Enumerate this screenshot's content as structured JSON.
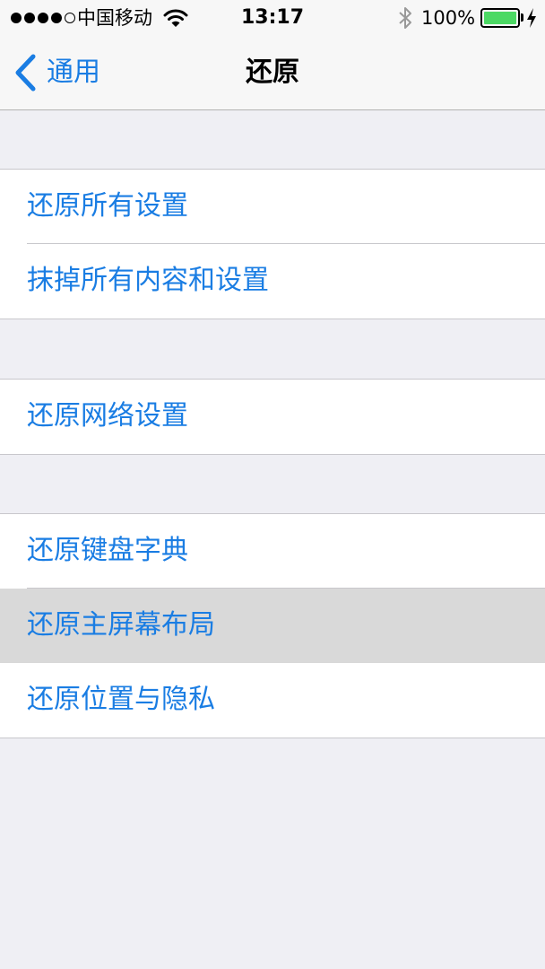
{
  "status_bar": {
    "carrier": "中国移动",
    "time": "13:17",
    "battery_percent": "100%",
    "signal_bars_filled": 4,
    "signal_bars_total": 5,
    "battery_level": 1.0,
    "battery_color": "#4cd964"
  },
  "nav": {
    "back_label": "通用",
    "title": "还原",
    "accent_color": "#1a7de3"
  },
  "groups": [
    {
      "items": [
        {
          "label": "还原所有设置"
        },
        {
          "label": "抹掉所有内容和设置"
        }
      ]
    },
    {
      "items": [
        {
          "label": "还原网络设置"
        }
      ]
    },
    {
      "items": [
        {
          "label": "还原键盘字典"
        },
        {
          "label": "还原主屏幕布局",
          "highlighted": true
        },
        {
          "label": "还原位置与隐私"
        }
      ]
    }
  ]
}
